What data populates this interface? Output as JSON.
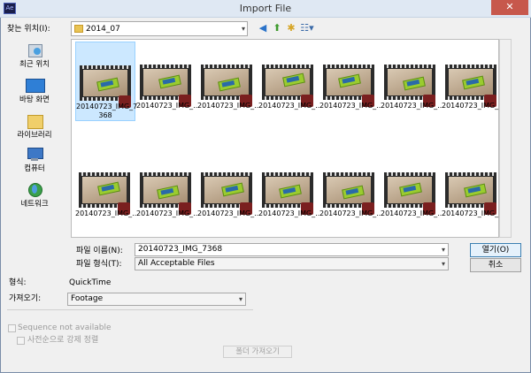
{
  "window": {
    "title": "Import File",
    "app_icon_text": "Ae",
    "close_glyph": "✕"
  },
  "lookin": {
    "label": "찾는 위치(I):",
    "value": "2014_07",
    "icons": [
      "back-icon",
      "up-folder-icon",
      "new-folder-icon",
      "view-menu-icon"
    ]
  },
  "places": [
    {
      "label": "최근 위치",
      "icon": "recent-places-icon"
    },
    {
      "label": "바탕 화면",
      "icon": "desktop-icon"
    },
    {
      "label": "라이브러리",
      "icon": "libraries-icon"
    },
    {
      "label": "컴퓨터",
      "icon": "computer-icon"
    },
    {
      "label": "네트워크",
      "icon": "network-icon"
    }
  ],
  "files": [
    {
      "label": "20140723_IMG_7\n368",
      "selected": true
    },
    {
      "label": "20140723_IMG_..."
    },
    {
      "label": "20140723_IMG_..."
    },
    {
      "label": "20140723_IMG_..."
    },
    {
      "label": "20140723_IMG_..."
    },
    {
      "label": "20140723_IMG_..."
    },
    {
      "label": "20140723_IMG_..."
    },
    {
      "label": "20140723_IMG_..."
    },
    {
      "label": "20140723_IMG_..."
    },
    {
      "label": "20140723_IMG_..."
    },
    {
      "label": "20140723_IMG_..."
    },
    {
      "label": "20140723_IMG_..."
    },
    {
      "label": "20140723_IMG_..."
    },
    {
      "label": "20140723_IMG_..."
    }
  ],
  "filename": {
    "label": "파일 이름(N):",
    "value": "20140723_IMG_7368"
  },
  "filetype": {
    "label": "파일 형식(T):",
    "value": "All Acceptable Files"
  },
  "buttons": {
    "open": "열기(O)",
    "cancel": "취소",
    "import_folder": "폴더 가져오기"
  },
  "format": {
    "label": "형식:",
    "value": "QuickTime"
  },
  "import_as": {
    "label": "가져오기:",
    "value": "Footage"
  },
  "options": {
    "sequence": "Sequence not available",
    "force_alpha": "사전순으로 강제 정렬"
  },
  "colors": {
    "selection": "#cce8ff",
    "close": "#c7584c",
    "phone": "#9acc2f"
  }
}
